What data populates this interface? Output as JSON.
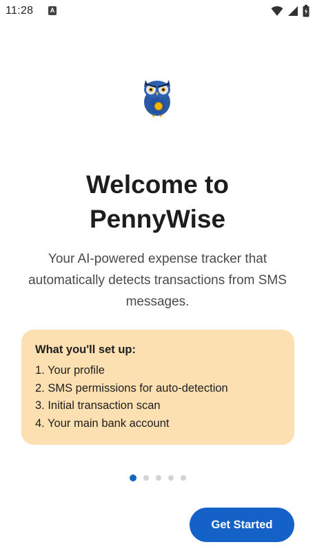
{
  "status_bar": {
    "time": "11:28",
    "notification_glyph": "A",
    "icons": [
      "wifi-icon",
      "signal-icon",
      "battery-icon"
    ]
  },
  "logo": {
    "icon": "owl-logo-icon"
  },
  "welcome": {
    "title_line1": "Welcome to",
    "title_line2": "PennyWise",
    "subtitle": "Your AI-powered expense tracker that automatically detects transactions from SMS messages."
  },
  "setup": {
    "heading": "What you'll set up:",
    "items": [
      "1. Your profile",
      "2. SMS permissions for auto-detection",
      "3. Initial transaction scan",
      "4. Your main bank account"
    ]
  },
  "pager": {
    "current_page": 1,
    "total_pages": 5
  },
  "actions": {
    "primary_label": "Get Started"
  },
  "colors": {
    "accent": "#1462c7",
    "card": "#fde0b1",
    "dot_inactive": "#d3d3d3"
  }
}
